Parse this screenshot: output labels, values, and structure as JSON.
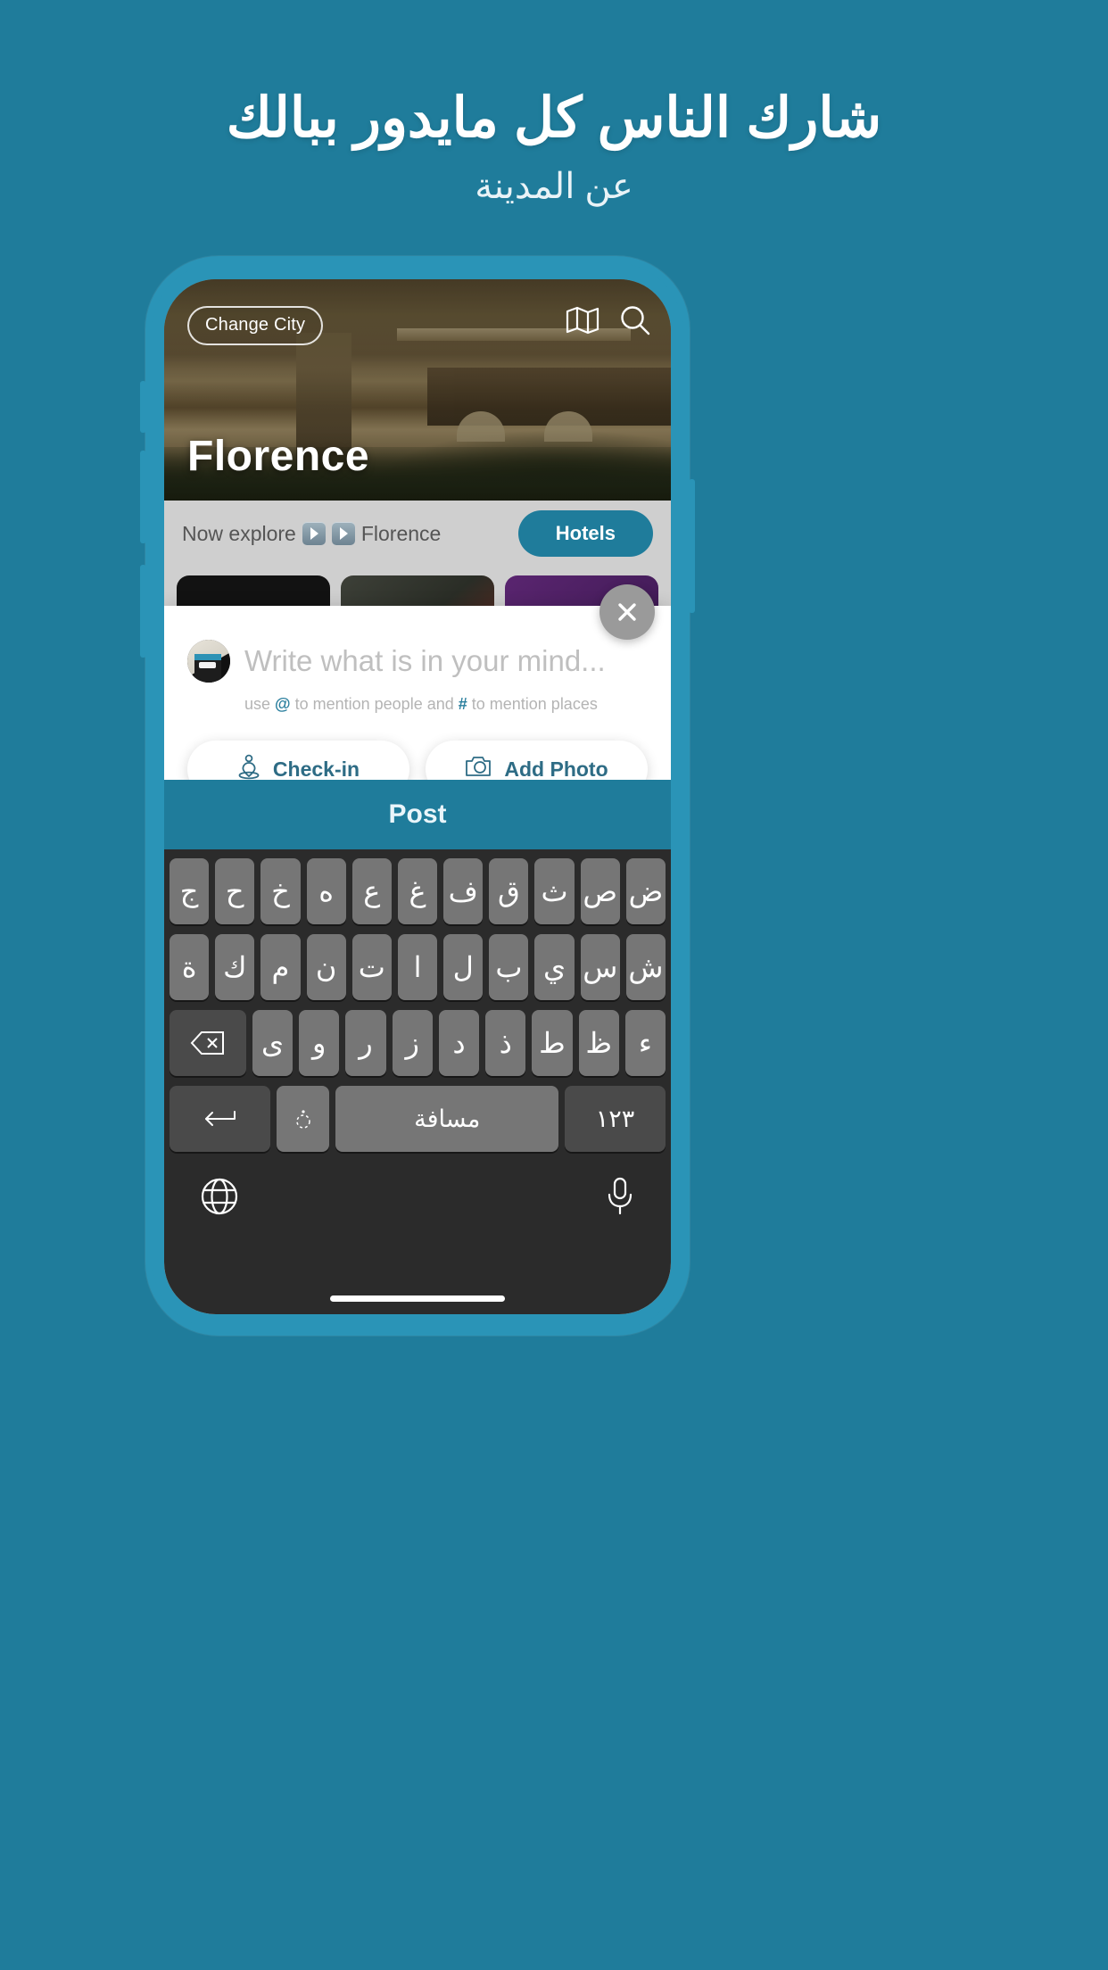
{
  "promo": {
    "headline": "شارك الناس كل مايدور ببالك",
    "subhead": "عن المدينة",
    "background_color": "#1F7C9B"
  },
  "phone": {
    "frame_color": "#2A94B7"
  },
  "app": {
    "hero": {
      "change_city_label": "Change City",
      "city_name": "Florence",
      "map_icon": "map-icon",
      "search_icon": "search-icon"
    },
    "explore_bar": {
      "prefix": "Now explore",
      "city": "Florence",
      "chevron_icon": "double-chevron-right-icon",
      "hotels_label": "Hotels"
    },
    "cards": [
      {
        "icon": "candle-icon"
      },
      {
        "icon": "steam-icon"
      },
      {
        "icon": "cocktail-icon"
      }
    ],
    "composer": {
      "close_icon": "close-icon",
      "avatar_icon": "avatar",
      "placeholder": "Write what is in your mind...",
      "hint_prefix": "use ",
      "hint_at": "@",
      "hint_mid": " to mention people and ",
      "hint_hash": "#",
      "hint_suffix": " to mention places",
      "accent_color": "#2A7F9E",
      "actions": [
        {
          "label": "Check-in",
          "icon": "location-person-icon"
        },
        {
          "label": "Add Photo",
          "icon": "camera-icon"
        }
      ]
    },
    "post_bar": {
      "label": "Post",
      "color": "#1F7C9B"
    },
    "keyboard": {
      "language": "Arabic",
      "rows": [
        [
          "ض",
          "ص",
          "ث",
          "ق",
          "ف",
          "غ",
          "ع",
          "ه",
          "خ",
          "ح",
          "ج"
        ],
        [
          "ش",
          "س",
          "ي",
          "ب",
          "ل",
          "ا",
          "ت",
          "ن",
          "م",
          "ك",
          "ة"
        ],
        [
          "ء",
          "ظ",
          "ط",
          "ذ",
          "د",
          "ز",
          "ر",
          "و",
          "ى"
        ]
      ],
      "backspace_icon": "backspace-icon",
      "numbers_key": "١٢٣",
      "space_key": "مسافة",
      "diacritic_key": "ـً",
      "return_icon": "return-icon",
      "globe_icon": "globe-icon",
      "mic_icon": "microphone-icon"
    }
  }
}
